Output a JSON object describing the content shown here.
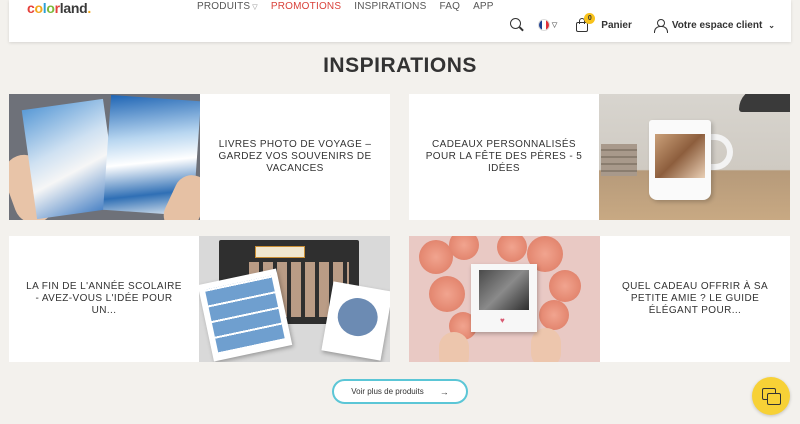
{
  "header": {
    "logo": {
      "c": "c",
      "o": "o",
      "l": "l",
      "o2": "o",
      "r": "r",
      "land": "land",
      "dot": "."
    },
    "nav": [
      {
        "label": "PRODUITS"
      },
      {
        "label": "PROMOTIONS"
      },
      {
        "label": "INSPIRATIONS"
      },
      {
        "label": "FAQ"
      },
      {
        "label": "APP"
      }
    ],
    "cart_count": "0",
    "cart_label": "Panier",
    "account_label": "Votre espace client"
  },
  "main": {
    "title": "INSPIRATIONS",
    "cards": [
      {
        "title": "LIVRES PHOTO DE VOYAGE – GARDEZ VOS SOUVENIRS DE VACANCES"
      },
      {
        "title": "CADEAUX PERSONNALISÉS POUR LA FÊTE DES PÈRES - 5 IDÉES"
      },
      {
        "title": "LA FIN DE L'ANNÉE SCOLAIRE - AVEZ-VOUS L'IDÉE POUR UN..."
      },
      {
        "title": "QUEL CADEAU OFFRIR À SA PETITE AMIE ? LE GUIDE ÉLÉGANT POUR..."
      }
    ],
    "more_button": "Voir plus de produits"
  },
  "colors": {
    "accent_red": "#d9413a",
    "cta_border": "#5bc6d6",
    "chat_yellow": "#f7d136",
    "page_bg": "#f3f1ed"
  },
  "icons": [
    "search-icon",
    "french-flag-icon",
    "cart-icon",
    "user-icon",
    "arrow-right-icon",
    "chat-icon"
  ]
}
